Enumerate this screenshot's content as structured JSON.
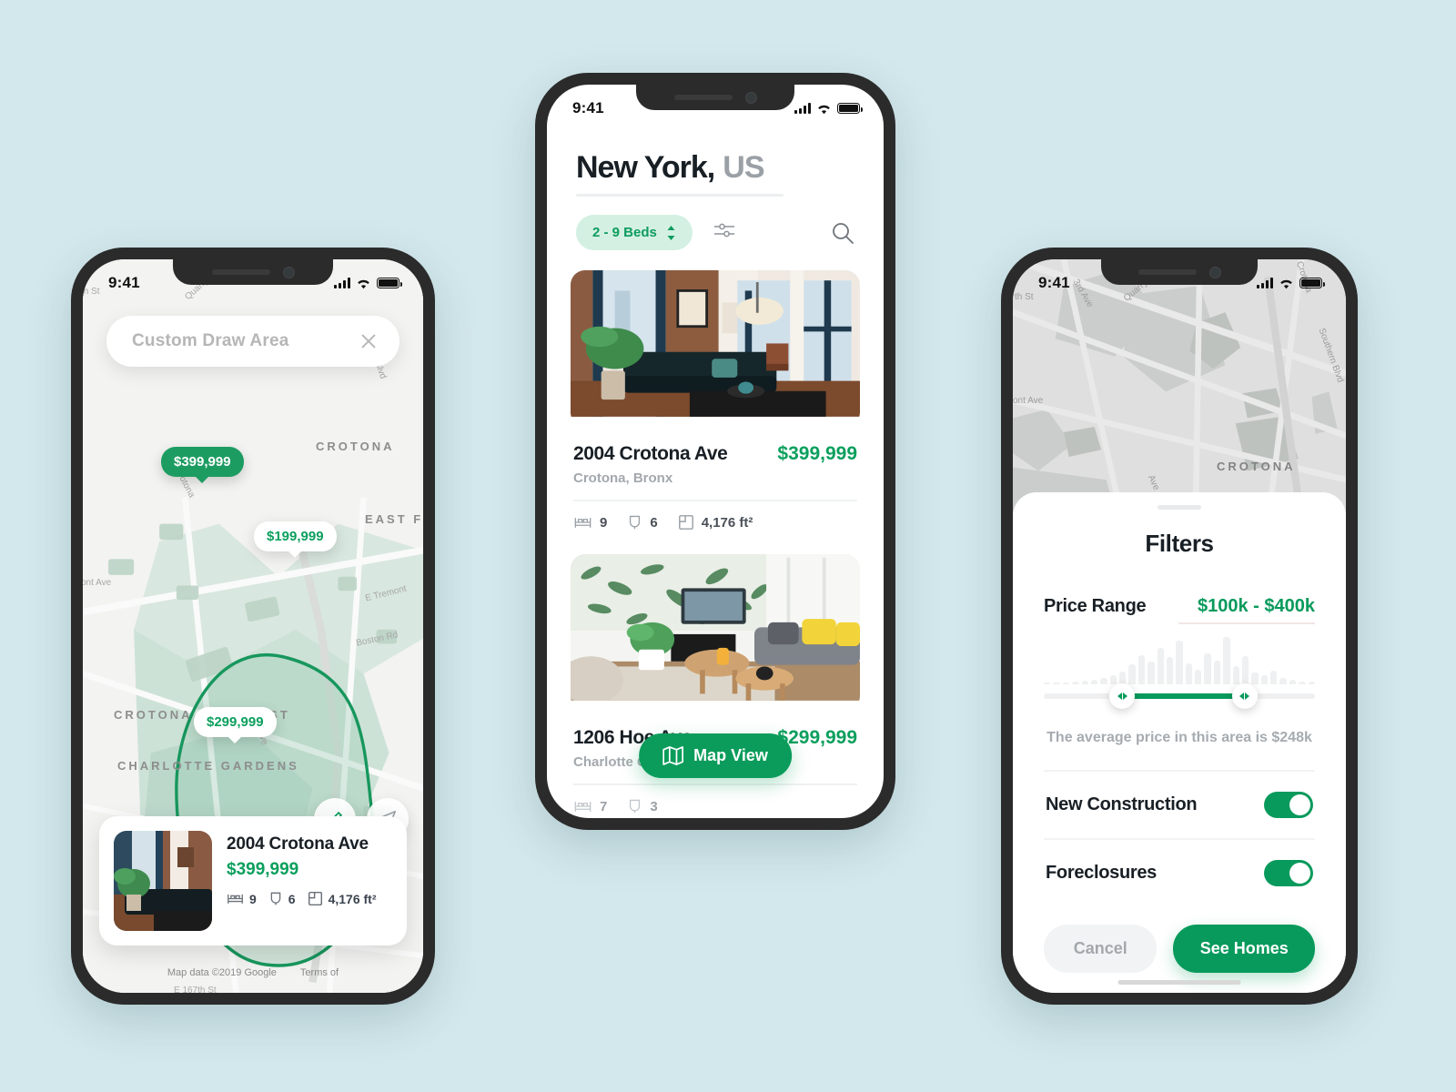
{
  "theme": {
    "background": "#d3e8ec",
    "accent_green": "#089a5c",
    "pin_green": "#1d9c62",
    "chip_bg": "#d4f0e2",
    "muted_text": "#a3a8ad"
  },
  "phone1": {
    "status": {
      "time": "9:41",
      "signal_icon": "cellular-bars-icon",
      "wifi_icon": "wifi-icon",
      "battery_icon": "battery-full-icon"
    },
    "search": {
      "placeholder": "Custom Draw Area",
      "value": "",
      "close_icon": "close-icon"
    },
    "map": {
      "area_labels": [
        "CROTONA",
        "EAST FA",
        "CROTONA PARK EAST",
        "CHARLOTTE GARDENS"
      ],
      "road_labels": [
        "th St",
        "Quarry Rd",
        "Southern Blvd",
        "ont Ave",
        "Crotona",
        "E Tremont",
        "Boston Rd",
        "E 167th St",
        "3rd Ave"
      ],
      "attribution": "Map data ©2019 Google",
      "terms": "Terms of"
    },
    "pins": [
      {
        "price": "$399,999",
        "state": "active"
      },
      {
        "price": "$199,999",
        "state": "plain"
      },
      {
        "price": "$299,999",
        "state": "plain"
      }
    ],
    "fabs": [
      {
        "name": "draw-edit-icon"
      },
      {
        "name": "locate-arrow-icon"
      }
    ],
    "card": {
      "address": "2004 Crotona Ave",
      "price": "$399,999",
      "beds": "9",
      "baths": "6",
      "area": "4,176 ft²"
    }
  },
  "phone2": {
    "status": {
      "time": "9:41"
    },
    "title_main": "New York,",
    "title_suffix": "US",
    "search_icon": "search-icon",
    "beds_chip": {
      "label": "2 - 9 Beds",
      "stepper_icon": "chevron-updown-icon"
    },
    "filter_icon": "sliders-filter-icon",
    "listings": [
      {
        "address": "2004 Crotona Ave",
        "price": "$399,999",
        "neighborhood": "Crotona, Bronx",
        "beds": "9",
        "baths": "6",
        "area": "4,176 ft²",
        "image": "loft-living-room-brick-wall-black-leather-sofa"
      },
      {
        "address": "1206 Hoe Ave",
        "price": "$299,999",
        "neighborhood": "Charlotte Gardens, Bronx",
        "beds": "7",
        "baths": "3",
        "area": "",
        "image": "living-room-tropical-leaf-wallpaper-yellow-cushions"
      }
    ],
    "map_view_button": {
      "label": "Map View",
      "icon": "map-folded-icon"
    }
  },
  "phone3": {
    "status": {
      "time": "9:41"
    },
    "map": {
      "area_labels": [
        "CROTONA"
      ],
      "road_labels": [
        "th St",
        "3rd Ave",
        "Quarry Rd",
        "Southern Blvd",
        "ont Ave",
        "Crotona",
        "Ave"
      ]
    },
    "sheet": {
      "title": "Filters",
      "price_range_label": "Price Range",
      "price_range_value": "$100k - $400k",
      "average_note": "The average price in this area is $248k",
      "toggles": [
        {
          "label": "New Construction",
          "on": true
        },
        {
          "label": "Foreclosures",
          "on": true
        }
      ],
      "cancel_label": "Cancel",
      "see_homes_label": "See Homes"
    },
    "histogram": {
      "values": [
        3,
        3,
        4,
        6,
        7,
        9,
        12,
        18,
        26,
        40,
        58,
        46,
        74,
        55,
        88,
        42,
        30,
        62,
        48,
        95,
        36,
        56,
        24,
        18,
        28,
        12,
        10,
        6,
        5
      ],
      "range_start_pct": 29,
      "range_end_pct": 74
    }
  }
}
